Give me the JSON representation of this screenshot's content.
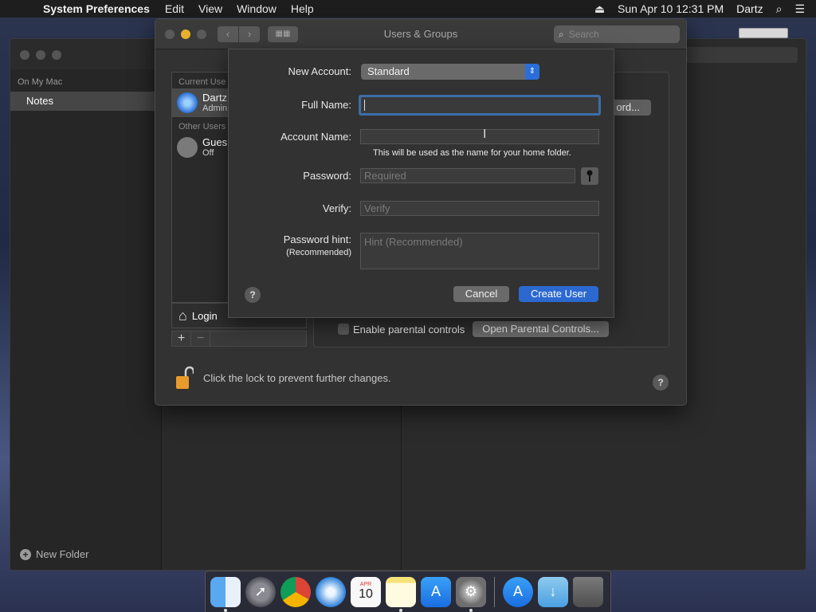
{
  "menubar": {
    "app": "System Preferences",
    "items": [
      "Edit",
      "View",
      "Window",
      "Help"
    ],
    "clock": "Sun Apr 10  12:31 PM",
    "user": "Dartz"
  },
  "notes": {
    "section": "On My Mac",
    "item": "Notes",
    "new_folder": "New Folder"
  },
  "window": {
    "title": "Users & Groups",
    "search_placeholder": "Search"
  },
  "users": {
    "current_header": "Current Use",
    "current_name": "Dartz",
    "current_role": "Admin",
    "other_header": "Other Users",
    "guest_name": "Gues",
    "guest_status": "Off",
    "login_options": "Login",
    "add": "+",
    "remove": "−"
  },
  "pane": {
    "password_button": "ord...",
    "parental_label": "Enable parental controls",
    "parental_button": "Open Parental Controls..."
  },
  "lock": {
    "text": "Click the lock to prevent further changes."
  },
  "sheet": {
    "new_account_label": "New Account:",
    "new_account_value": "Standard",
    "full_name_label": "Full Name:",
    "full_name_value": "",
    "account_name_label": "Account Name:",
    "account_name_value": "",
    "account_name_note": "This will be used as the name for your home folder.",
    "password_label": "Password:",
    "password_placeholder": "Required",
    "verify_label": "Verify:",
    "verify_placeholder": "Verify",
    "hint_label": "Password hint:",
    "hint_sub": "(Recommended)",
    "hint_placeholder": "Hint (Recommended)",
    "help": "?",
    "cancel": "Cancel",
    "create": "Create User"
  },
  "dock": {
    "calendar_month": "APR",
    "calendar_day": "10"
  }
}
